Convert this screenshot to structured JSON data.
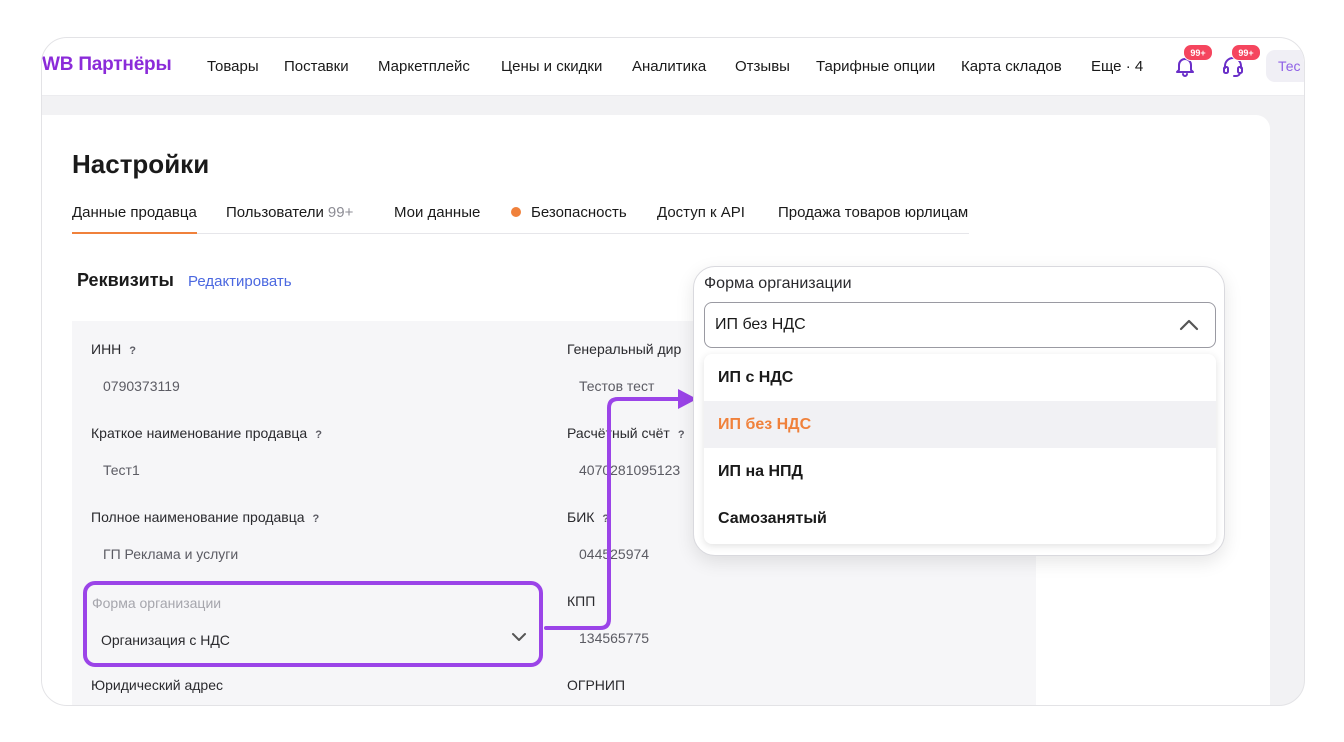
{
  "header": {
    "logo": "WB Партнёры",
    "nav": [
      "Товары",
      "Поставки",
      "Маркетплейс",
      "Цены и скидки",
      "Аналитика",
      "Отзывы",
      "Тарифные опции",
      "Карта складов",
      "Еще · 4"
    ],
    "notifications_badge": "99+",
    "support_badge": "99+",
    "user_label": "Тес"
  },
  "page": {
    "title": "Настройки",
    "tabs": [
      {
        "label": "Данные продавца"
      },
      {
        "label": "Пользователи",
        "count": "99+"
      },
      {
        "label": "Мои данные"
      },
      {
        "label": "Безопасность"
      },
      {
        "label": "Доступ к API"
      },
      {
        "label": "Продажа товаров юрлицам"
      }
    ]
  },
  "requisites": {
    "title": "Реквизиты",
    "edit_label": "Редактировать",
    "q": "?",
    "left": [
      {
        "label": "ИНН",
        "value": "0790373119"
      },
      {
        "label": "Краткое наименование продавца",
        "value": "Тест1"
      },
      {
        "label": "Полное наименование продавца",
        "value": "ГП Реклама и услуги"
      }
    ],
    "org_form": {
      "label": "Форма организации",
      "value": "Организация с НДС"
    },
    "legal_address_label": "Юридический адрес",
    "right": [
      {
        "label": "Генеральный дир",
        "value": "Тестов тест"
      },
      {
        "label": "Расчётный счёт",
        "value": "4070281095123"
      },
      {
        "label": "БИК",
        "value": "044525974"
      },
      {
        "label": "КПП",
        "value": "134565775"
      }
    ],
    "ogrnip_label": "ОГРНИП"
  },
  "dropdown": {
    "label": "Форма организации",
    "selected": "ИП без НДС",
    "options": [
      "ИП с НДС",
      "ИП без НДС",
      "ИП на НПД",
      "Самозанятый"
    ]
  },
  "colors": {
    "brand": "#8b2bd9",
    "accent_orange": "#f0813b",
    "highlight_purple": "#9b44e8",
    "link_blue": "#4b68e0",
    "badge_red": "#f5455e"
  }
}
